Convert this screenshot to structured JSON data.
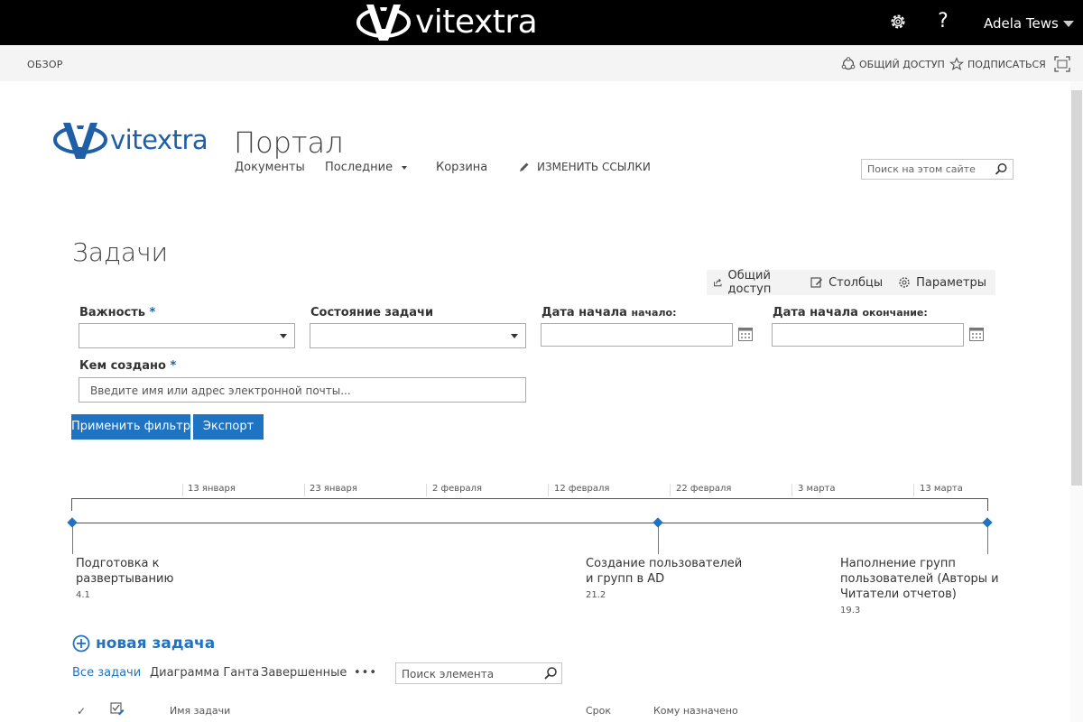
{
  "suitebar": {
    "brand": "vitextra",
    "user": "Adela Tews",
    "help": "?",
    "icons": [
      "gear-icon",
      "help-icon",
      "chevron-down-icon"
    ]
  },
  "ribbon": {
    "browse": "ОБЗОР",
    "share": "ОБЩИЙ ДОСТУП",
    "follow": "ПОДПИСАТЬСЯ"
  },
  "site": {
    "logo_text": "vitextra",
    "title": "Портал",
    "nav": {
      "documents": "Документы",
      "recent": "Последние",
      "recycle": "Корзина",
      "edit_links": "ИЗМЕНИТЬ ССЫЛКИ"
    },
    "search_placeholder": "Поиск на этом сайте"
  },
  "page": {
    "title": "Задачи"
  },
  "toolbar": {
    "share": "Общий доступ",
    "columns": "Столбцы",
    "settings": "Параметры"
  },
  "form": {
    "importance_label": "Важность",
    "state_label": "Состояние задачи",
    "start_from_label": "Дата начала",
    "start_from_sub": "начало:",
    "start_to_label": "Дата начала",
    "start_to_sub": "окончание:",
    "created_by_label": "Кем создано",
    "required_mark": "*",
    "people_placeholder": "Введите имя или адрес электронной почты...",
    "apply_button": "Применить фильтр",
    "export_button": "Экспорт"
  },
  "timeline": {
    "ticks": [
      "13 января",
      "23 января",
      "2 февраля",
      "12 февраля",
      "22 февраля",
      "3 марта",
      "13 марта"
    ],
    "tasks": [
      {
        "line1": "Подготовка к",
        "line2": "развертыванию",
        "line3": "",
        "date": "4.1"
      },
      {
        "line1": "Создание пользователей",
        "line2": "и групп в AD",
        "line3": "",
        "date": "21.2"
      },
      {
        "line1": "Наполнение групп",
        "line2": "пользователей (Авторы и",
        "line3": "Читатели отчетов)",
        "date": "19.3"
      }
    ]
  },
  "list": {
    "new_task": "новая задача",
    "views": [
      "Все задачи",
      "Диаграмма Ганта",
      "Завершенные"
    ],
    "active_view": "Все задачи",
    "more": "•••",
    "search_placeholder": "Поиск элемента",
    "columns": {
      "check": "✓",
      "task_name": "Имя задачи",
      "due": "Срок",
      "assigned_to": "Кому назначено"
    }
  },
  "colors": {
    "accent": "#1f73c3",
    "logo_blue": "#1f5fa8",
    "suitebar": "#000000",
    "ribbon": "#f4f4f4"
  }
}
